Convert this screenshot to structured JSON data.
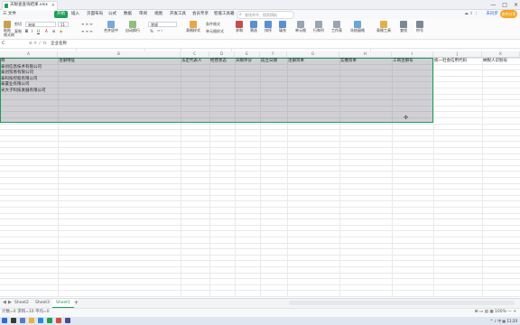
{
  "window": {
    "file_tab_label": "天眼查查询结果.xlsx",
    "close_glyph": "×",
    "controls": [
      "—",
      "□",
      "×"
    ]
  },
  "menu": {
    "items": [
      "三 文件",
      "开始",
      "插入",
      "页面布局",
      "公式",
      "数据",
      "审阅",
      "视图",
      "开发工具",
      "会员专享",
      "智能工具箱"
    ],
    "search_placeholder": "查找命令、搜索模板",
    "right_icons": "☁ ⇪ ⋮",
    "cloud_sync": "未同步",
    "collab_button": "协作分享"
  },
  "ribbon": {
    "paste": "粘贴",
    "cut": "剪切",
    "copy": "复制",
    "format_painter": "格式刷",
    "font_name": "宋体",
    "font_size": "11",
    "bold": "B",
    "italic": "I",
    "underline": "U",
    "merge_center": "合并居中",
    "wrap_text": "自动换行",
    "number_format": "常规",
    "percent": "%",
    "table_style": "表格样式",
    "conditional_format": "条件格式",
    "cell_style": "单元格样式",
    "sum": "求和",
    "filter": "筛选",
    "sort": "排序",
    "fill": "填充",
    "cell": "单元格",
    "row_col": "行和列",
    "worksheet": "工作表",
    "freeze": "冻结窗格",
    "table_tools": "表格工具",
    "find": "查找",
    "symbol": "符号"
  },
  "formula_bar": {
    "name_box": "C",
    "fx_icons": "⊕ ✕ ✓ fx",
    "content": "企业名称"
  },
  "columns": [
    "A",
    "B",
    "C",
    "D",
    "E",
    "F",
    "G",
    "H",
    "I",
    "J",
    "K"
  ],
  "table": {
    "headers": [
      "称",
      "注册地址",
      "法定代表人",
      "经营状态",
      "天眼评分",
      "成立日期",
      "注册资本",
      "实缴资本",
      "工商注册号",
      "统一社会信用代码",
      "纳税人识别号"
    ],
    "rows": [
      "泰创信息技术有限公司",
      "泰创贸易有限公司",
      "泰科技控股有限公司",
      "泰置业有限公司",
      "光大子科技发展有限公司"
    ]
  },
  "sheets": {
    "nav": [
      "◀",
      "▶",
      "▷"
    ],
    "tabs": [
      "Sheet2",
      "Sheet3",
      "Sheet1"
    ],
    "add": "+"
  },
  "status": {
    "left": "计数=0  求和=10  平均=0",
    "right": "⊞ ▭ ▤ ▦  100%  —  +"
  },
  "taskbar": {
    "tray": "^ ♪ 中 ▦ 11:20"
  },
  "colors": {
    "accent": "#1e9e58",
    "selection_overlay": "#6e6e78",
    "collab": "#f5a623"
  }
}
